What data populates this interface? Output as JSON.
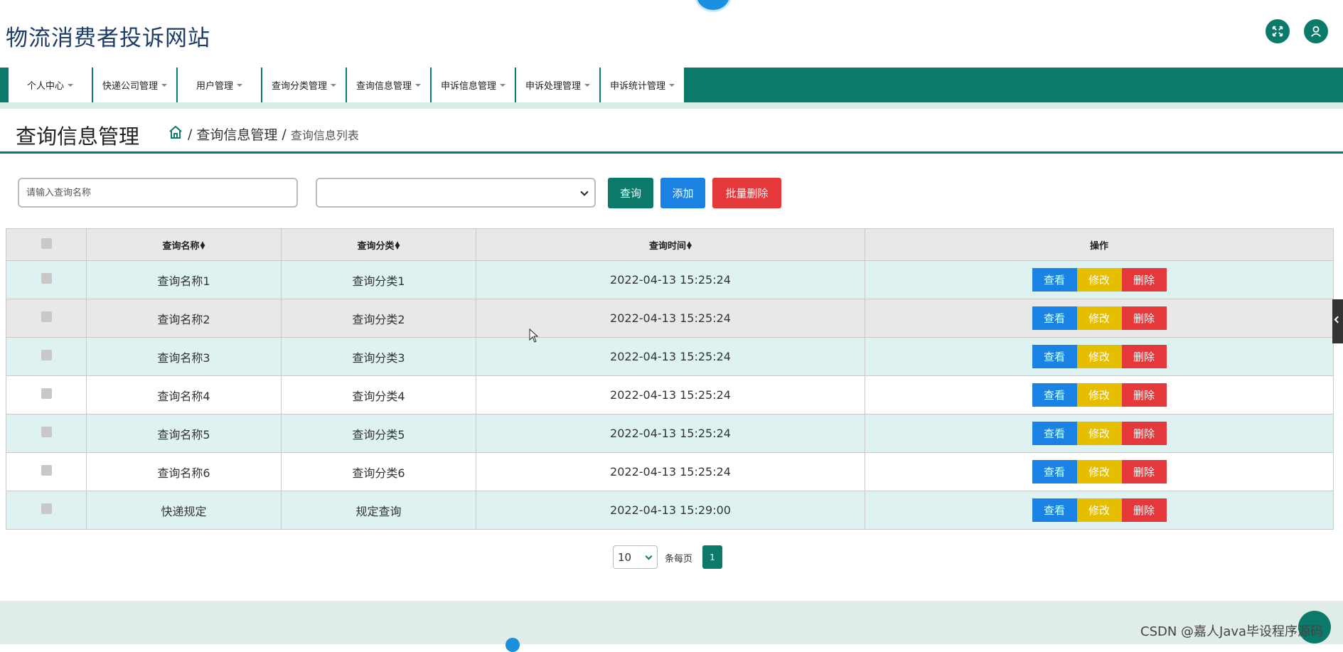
{
  "site_title": "物流消费者投诉网站",
  "nav": [
    {
      "label": "个人中心"
    },
    {
      "label": "快递公司管理"
    },
    {
      "label": "用户管理"
    },
    {
      "label": "查询分类管理"
    },
    {
      "label": "查询信息管理"
    },
    {
      "label": "申诉信息管理"
    },
    {
      "label": "申诉处理管理"
    },
    {
      "label": "申诉统计管理"
    }
  ],
  "page_title": "查询信息管理",
  "breadcrumb": {
    "section": "查询信息管理",
    "current": "查询信息列表",
    "separator": "/"
  },
  "search": {
    "placeholder": "请输入查询名称",
    "category_value": ""
  },
  "buttons": {
    "query": "查询",
    "add": "添加",
    "batch_delete": "批量删除"
  },
  "table": {
    "headers": {
      "name": "查询名称",
      "category": "查询分类",
      "time": "查询时间",
      "actions": "操作"
    },
    "rows": [
      {
        "name": "查询名称1",
        "category": "查询分类1",
        "time": "2022-04-13 15:25:24"
      },
      {
        "name": "查询名称2",
        "category": "查询分类2",
        "time": "2022-04-13 15:25:24"
      },
      {
        "name": "查询名称3",
        "category": "查询分类3",
        "time": "2022-04-13 15:25:24"
      },
      {
        "name": "查询名称4",
        "category": "查询分类4",
        "time": "2022-04-13 15:25:24"
      },
      {
        "name": "查询名称5",
        "category": "查询分类5",
        "time": "2022-04-13 15:25:24"
      },
      {
        "name": "查询名称6",
        "category": "查询分类6",
        "time": "2022-04-13 15:25:24"
      },
      {
        "name": "快递规定",
        "category": "规定查询",
        "time": "2022-04-13 15:29:00"
      }
    ],
    "row_actions": {
      "view": "查看",
      "edit": "修改",
      "delete": "删除"
    }
  },
  "pagination": {
    "page_size": "10",
    "page_size_label": "条每页",
    "current_page": "1"
  },
  "watermark": "CSDN @嘉人Java毕设程序源码",
  "colors": {
    "primary": "#0b7a6b",
    "blue": "#1a82e2",
    "yellow": "#e6be00",
    "red": "#e5383b",
    "title": "#1d3c66"
  },
  "icons": {
    "expand": "expand-icon",
    "user": "user-icon",
    "home": "home-icon"
  }
}
